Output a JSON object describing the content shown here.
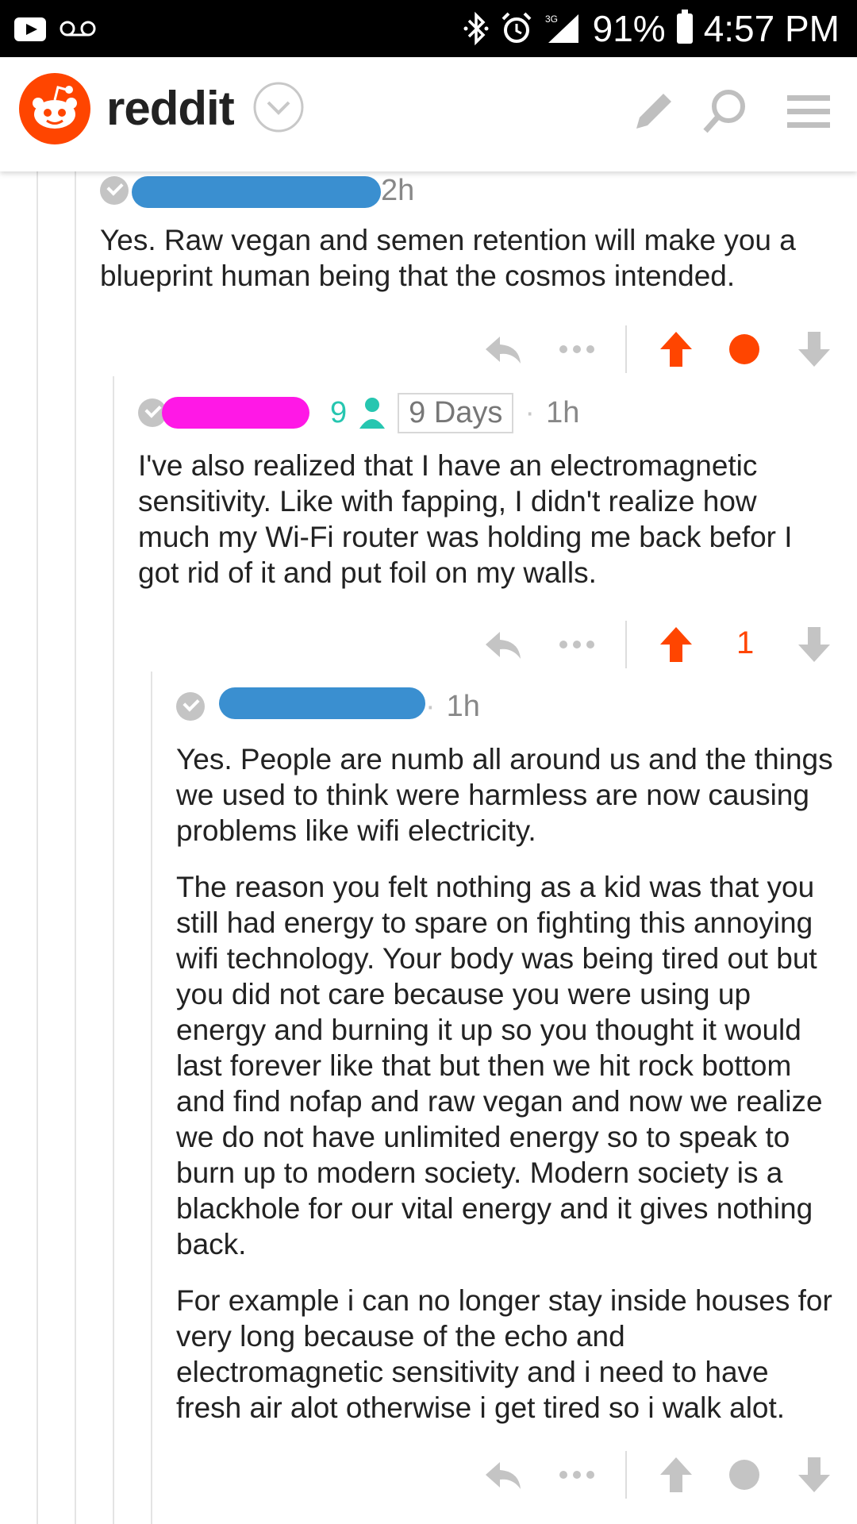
{
  "statusbar": {
    "battery": "91%",
    "time": "4:57 PM",
    "network": "3G"
  },
  "header": {
    "brand": "reddit"
  },
  "comments": [
    {
      "meta_time": "2h",
      "body": [
        "Yes. Raw vegan and semen retention will make you a blueprint human being that the cosmos intended."
      ],
      "vote": "upvoted",
      "score": ""
    },
    {
      "meta_suffix": "9",
      "flair": "9 Days",
      "meta_time": "1h",
      "body": [
        "I've also realized that I have an electromagnetic sensitivity. Like with fapping, I didn't realize how much my Wi-Fi router was holding me back befor I got rid of it and put foil on my walls."
      ],
      "vote": "upvoted",
      "score": "1"
    },
    {
      "meta_time": "1h",
      "body": [
        "Yes. People are numb all around us and the things we used to think were harmless are now causing problems like wifi electricity.",
        "The reason you felt nothing as a kid was that you still had energy to spare on fighting this annoying wifi technology. Your body was being tired out but you did not care because you were using up energy and burning it up so you thought it would last forever like that but then we hit rock bottom and find nofap and raw vegan and now we realize we do not have unlimited energy so to speak to burn up to modern society. Modern society is a blackhole for our vital energy and it gives nothing back.",
        "For example i can no longer stay inside houses for very long because of the echo and electromagnetic sensitivity and i need to have fresh air alot otherwise i get tired so i walk alot."
      ],
      "vote": "none",
      "score": ""
    }
  ],
  "colors": {
    "upvote": "#ff4500",
    "redact_blue": "#3a8fd0",
    "redact_pink": "#ff18e6",
    "mod_teal": "#26c6b0"
  }
}
